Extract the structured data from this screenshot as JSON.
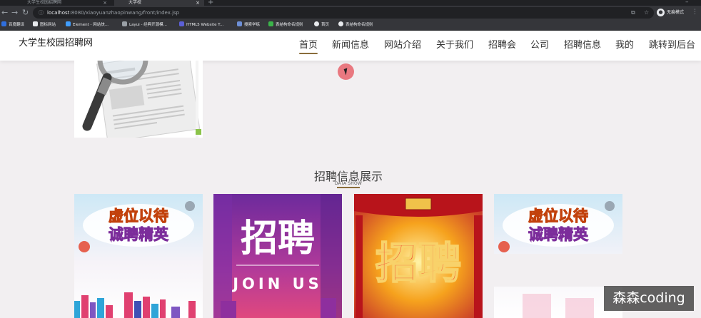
{
  "browser": {
    "tabs": [
      {
        "title": "大学生校园招聘网"
      },
      {
        "title": "大学校"
      }
    ],
    "address": {
      "host": "localhost",
      "path": ":8080/xiaoyuanzhaopinwang/front/index.jsp"
    },
    "profile_label": "无痕模式",
    "bookmarks": [
      "百度翻译",
      "图标网站",
      "Element - 网站快...",
      "Layui - 经典开源模...",
      "HTML5 Website T...",
      "搜索学练",
      "表结构命名规则",
      "首页",
      "表结构命名规则"
    ]
  },
  "site": {
    "title": "大学生校园招聘网",
    "nav": [
      {
        "label": "首页",
        "active": true
      },
      {
        "label": "新闻信息",
        "active": false
      },
      {
        "label": "网站介绍",
        "active": false
      },
      {
        "label": "关于我们",
        "active": false
      },
      {
        "label": "招聘会",
        "active": false
      },
      {
        "label": "公司",
        "active": false
      },
      {
        "label": "招聘信息",
        "active": false
      },
      {
        "label": "我的",
        "active": false
      },
      {
        "label": "跳转到后台",
        "active": false
      }
    ]
  },
  "section": {
    "title": "招聘信息展示",
    "subtitle": "DATA SHOW"
  },
  "posters": [
    {
      "headline": "虚位以待",
      "sub": "诚聘精英",
      "theme": "sky"
    },
    {
      "headline": "招聘",
      "sub": "JOIN US",
      "theme": "purple"
    },
    {
      "headline": "招聘",
      "sub": "",
      "theme": "red-gold"
    },
    {
      "headline": "虚位以待",
      "sub": "诚聘精英",
      "theme": "sky"
    }
  ],
  "watermark": "森森coding",
  "colors": {
    "accent": "#8a6d3b",
    "page_bg": "#f2eff1"
  }
}
